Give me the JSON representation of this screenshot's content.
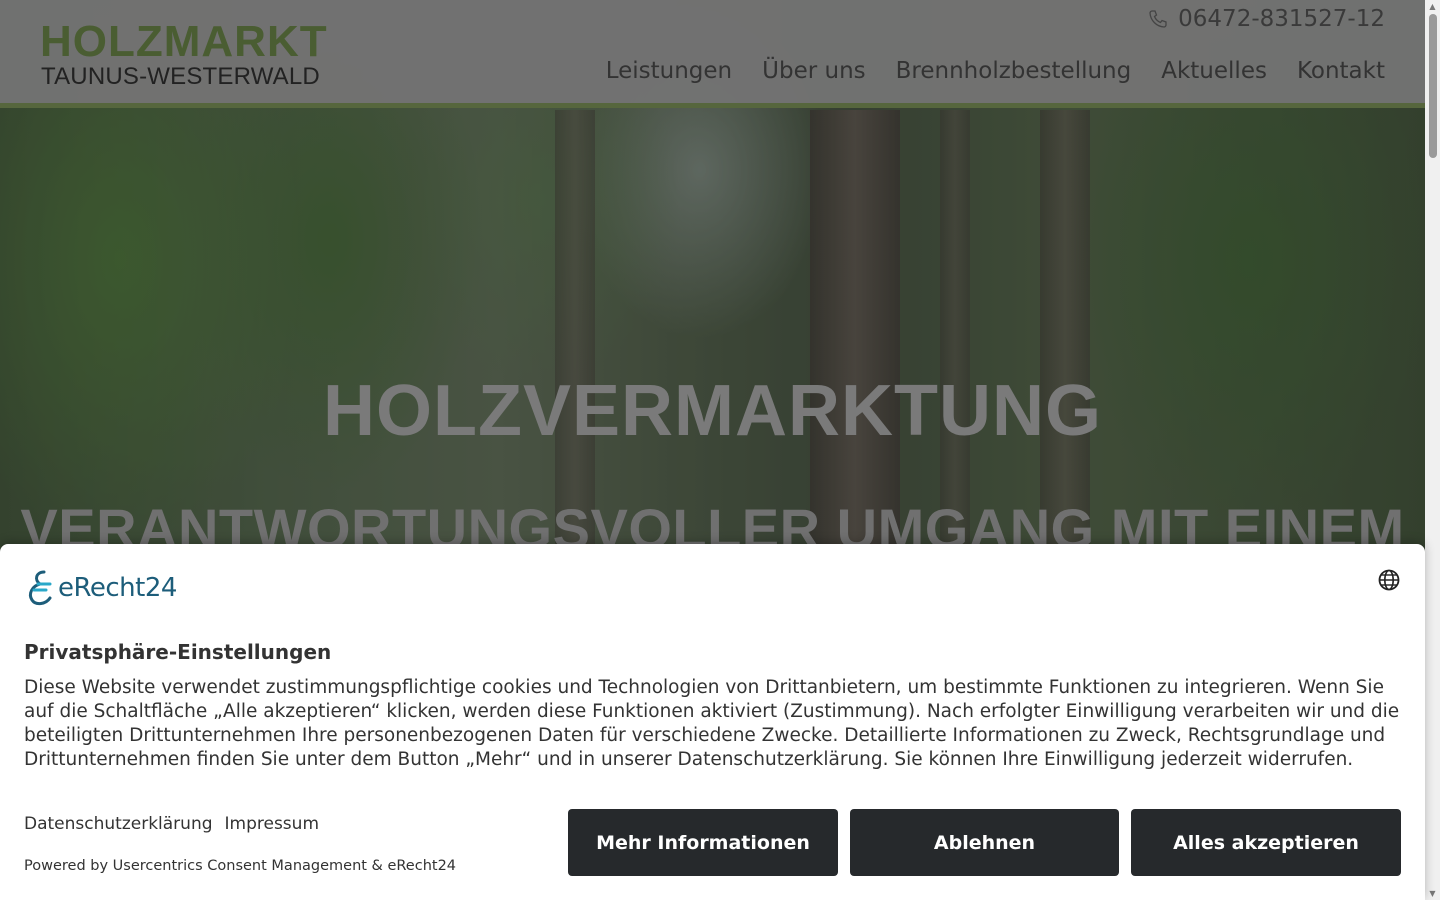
{
  "header": {
    "logo_top": "HOLZMARKT",
    "logo_bottom": "TAUNUS-WESTERWALD",
    "phone": "06472-831527-12",
    "phone_icon": "phone-icon",
    "nav": [
      "Leistungen",
      "Über uns",
      "Brennholzbestellung",
      "Aktuelles",
      "Kontakt"
    ]
  },
  "hero": {
    "title": "HOLZVERMARKTUNG",
    "subtitle": "VERANTWORTUNGSVOLLER UMGANG MIT EINEM"
  },
  "consent": {
    "brand": "eRecht24",
    "language_icon": "globe-icon",
    "title": "Privatsphäre-Einstellungen",
    "body": "Diese Website verwendet zustimmungspflichtige cookies und Technologien von Drittanbietern, um bestimmte Funktionen zu integrieren. Wenn Sie auf die Schaltfläche „Alle akzeptieren“ klicken, werden diese Funktionen aktiviert (Zustimmung). Nach erfolgter Einwilligung verarbeiten wir und die beteiligten Drittunternehmen Ihre personenbezogenen Daten für verschiedene Zwecke. Detaillierte Informationen zu Zweck, Rechtsgrundlage und Drittunternehmen finden Sie unter dem Button „Mehr“ und in unserer Datenschutzerklärung. Sie können Ihre Einwilligung jederzeit widerrufen.",
    "links": {
      "privacy": "Datenschutzerklärung",
      "imprint": "Impressum"
    },
    "powered_by": "Powered by Usercentrics Consent Management & eRecht24",
    "buttons": {
      "more": "Mehr Informationen",
      "deny": "Ablehnen",
      "accept": "Alles akzeptieren"
    }
  },
  "colors": {
    "header_bg": "#737373",
    "header_border": "#56663d",
    "logo_green": "#4a5d32",
    "button_bg": "#26292c",
    "brand_blue": "#1d5d7a"
  }
}
